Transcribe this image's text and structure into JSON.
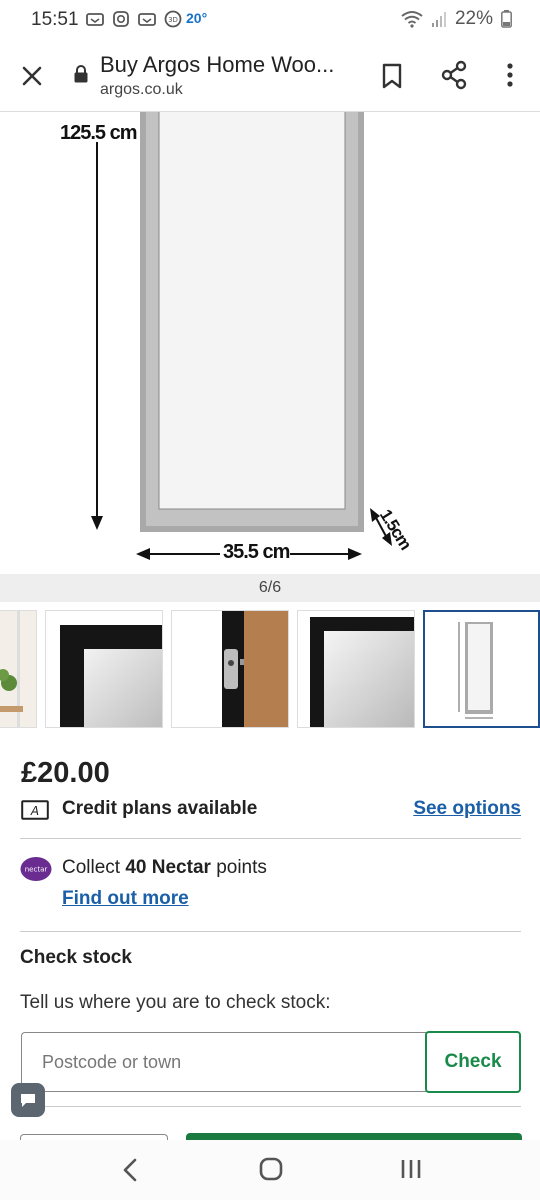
{
  "status_bar": {
    "time": "15:51",
    "temperature": "20°",
    "battery": "22%"
  },
  "browser": {
    "page_title": "Buy Argos Home Woo...",
    "url": "argos.co.uk"
  },
  "product_image": {
    "height_label": "125.5 cm",
    "width_label": "35.5 cm",
    "depth_label": "1.5cm",
    "counter": "6/6"
  },
  "thumbnails": [
    {
      "name": "thumb-room-partial",
      "active": false
    },
    {
      "name": "thumb-mirror-corner",
      "active": false
    },
    {
      "name": "thumb-wall-hook",
      "active": false
    },
    {
      "name": "thumb-mirror-closeup",
      "active": false
    },
    {
      "name": "thumb-dimensions",
      "active": true
    }
  ],
  "pricing": {
    "price": "£20.00",
    "credit_text": "Credit plans available",
    "see_options": "See options"
  },
  "nectar": {
    "collect_prefix": "Collect ",
    "points": "40 Nectar",
    "collect_suffix": " points",
    "find_out_more": "Find out more",
    "brand_color": "#6a2c91"
  },
  "check_stock": {
    "title": "Check stock",
    "description": "Tell us where you are to check stock:",
    "placeholder": "Postcode or town",
    "button_label": "Check",
    "accent_color": "#1a8a4a"
  }
}
